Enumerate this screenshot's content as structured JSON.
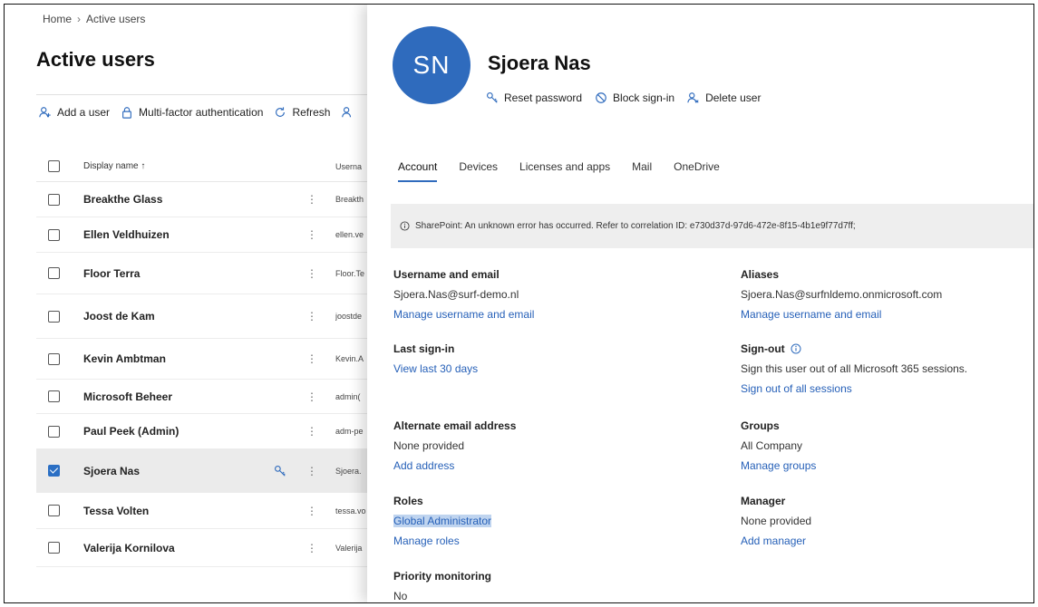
{
  "breadcrumb": {
    "home": "Home",
    "current": "Active users"
  },
  "page_title": "Active users",
  "commands": {
    "add_user": "Add a user",
    "mfa": "Multi-factor authentication",
    "refresh": "Refresh"
  },
  "table": {
    "header": {
      "display_name": "Display name ↑",
      "username": "Userna"
    },
    "rows": [
      {
        "name": "Breakthe Glass",
        "username": "Breakth",
        "selected": false
      },
      {
        "name": "Ellen Veldhuizen",
        "username": "ellen.ve",
        "selected": false
      },
      {
        "name": "Floor Terra",
        "username": "Floor.Te",
        "selected": false
      },
      {
        "name": "Joost de Kam",
        "username": "joostde",
        "selected": false
      },
      {
        "name": "Kevin Ambtman",
        "username": "Kevin.A",
        "selected": false
      },
      {
        "name": "Microsoft Beheer",
        "username": "admin(",
        "selected": false
      },
      {
        "name": "Paul Peek (Admin)",
        "username": "adm-pe",
        "selected": false
      },
      {
        "name": "Sjoera Nas",
        "username": "Sjoera.",
        "selected": true
      },
      {
        "name": "Tessa Volten",
        "username": "tessa.vo",
        "selected": false
      },
      {
        "name": "Valerija Kornilova",
        "username": "Valerija",
        "selected": false
      }
    ]
  },
  "panel": {
    "initials": "SN",
    "name": "Sjoera Nas",
    "actions": {
      "reset_password": "Reset password",
      "block_signin": "Block sign-in",
      "delete_user": "Delete user"
    },
    "tabs": [
      "Account",
      "Devices",
      "Licenses and apps",
      "Mail",
      "OneDrive"
    ],
    "active_tab": "Account",
    "banner": "SharePoint: An unknown error has occurred. Refer to correlation ID: e730d37d-97d6-472e-8f15-4b1e9f77d7ff;",
    "fields": {
      "username_label": "Username and email",
      "username_value": "Sjoera.Nas@surf-demo.nl",
      "username_link": "Manage username and email",
      "aliases_label": "Aliases",
      "aliases_value": "Sjoera.Nas@surfnldemo.onmicrosoft.com",
      "aliases_link": "Manage username and email",
      "lastsignin_label": "Last sign-in",
      "lastsignin_link": "View last 30 days",
      "signout_label": "Sign-out",
      "signout_value": "Sign this user out of all Microsoft 365 sessions.",
      "signout_link": "Sign out of all sessions",
      "altemail_label": "Alternate email address",
      "altemail_value": "None provided",
      "altemail_link": "Add address",
      "groups_label": "Groups",
      "groups_value": "All Company",
      "groups_link": "Manage groups",
      "roles_label": "Roles",
      "roles_value": "Global Administrator",
      "roles_link": "Manage roles",
      "manager_label": "Manager",
      "manager_value": "None provided",
      "manager_link": "Add manager",
      "priority_label": "Priority monitoring",
      "priority_value": "No"
    }
  },
  "colors": {
    "accent": "#2f6bbd",
    "link": "#2660b8",
    "highlight": "#bfd4ef",
    "selected_row": "#ebebeb"
  }
}
